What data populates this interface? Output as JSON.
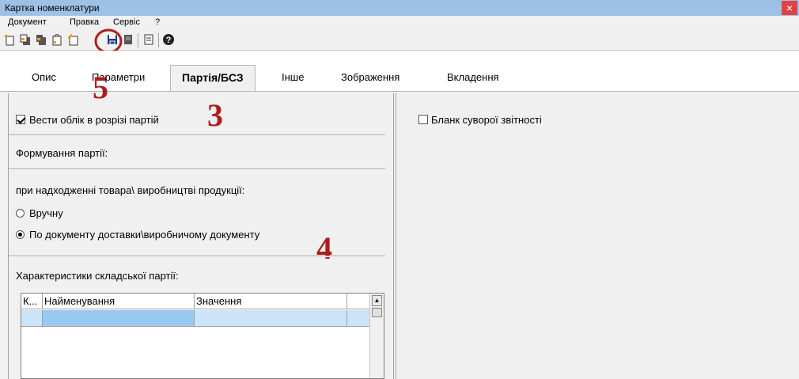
{
  "window": {
    "title": "Картка номенклатури",
    "close_glyph": "×"
  },
  "menu": {
    "items": [
      {
        "label": "Документ"
      },
      {
        "label": "Правка"
      },
      {
        "label": "Сервіс"
      },
      {
        "label": "?"
      }
    ]
  },
  "toolbar": {
    "icons": [
      "new-doc-icon",
      "copy-doc-icon",
      "copy-doc-2-icon",
      "edit-doc-icon",
      "refresh-doc-icon",
      "save-icon",
      "delete-icon",
      "form-icon",
      "help-icon"
    ],
    "help_glyph": "?"
  },
  "tabs": [
    {
      "label": "Опис"
    },
    {
      "label": "Параметри"
    },
    {
      "label": "Партія/БСЗ",
      "active": true
    },
    {
      "label": "Інше"
    },
    {
      "label": "Зображення"
    },
    {
      "label": "Вкладення"
    }
  ],
  "left": {
    "batch_checkbox": {
      "label": "Вести облік в розрізі партій",
      "checked": true
    },
    "formation_heading": "Формування партії:",
    "receipt_heading": "при надходженні товара\\ виробництві продукції:",
    "radio_manual": {
      "label": "Вручну",
      "selected": false
    },
    "radio_document": {
      "label": "По документу доставки\\виробничому документу",
      "selected": true
    },
    "characteristics_heading": "Характеристики складської партії:",
    "grid": {
      "columns": [
        "К...",
        "Найменування",
        "Значення"
      ],
      "scroll_up_glyph": "▲"
    }
  },
  "right": {
    "strict_form_checkbox": {
      "label": "Бланк суворої звітності",
      "checked": false
    }
  },
  "annotations": {
    "step3": "3",
    "step4": "4",
    "step5": "5",
    "color": "#b01c1c"
  }
}
